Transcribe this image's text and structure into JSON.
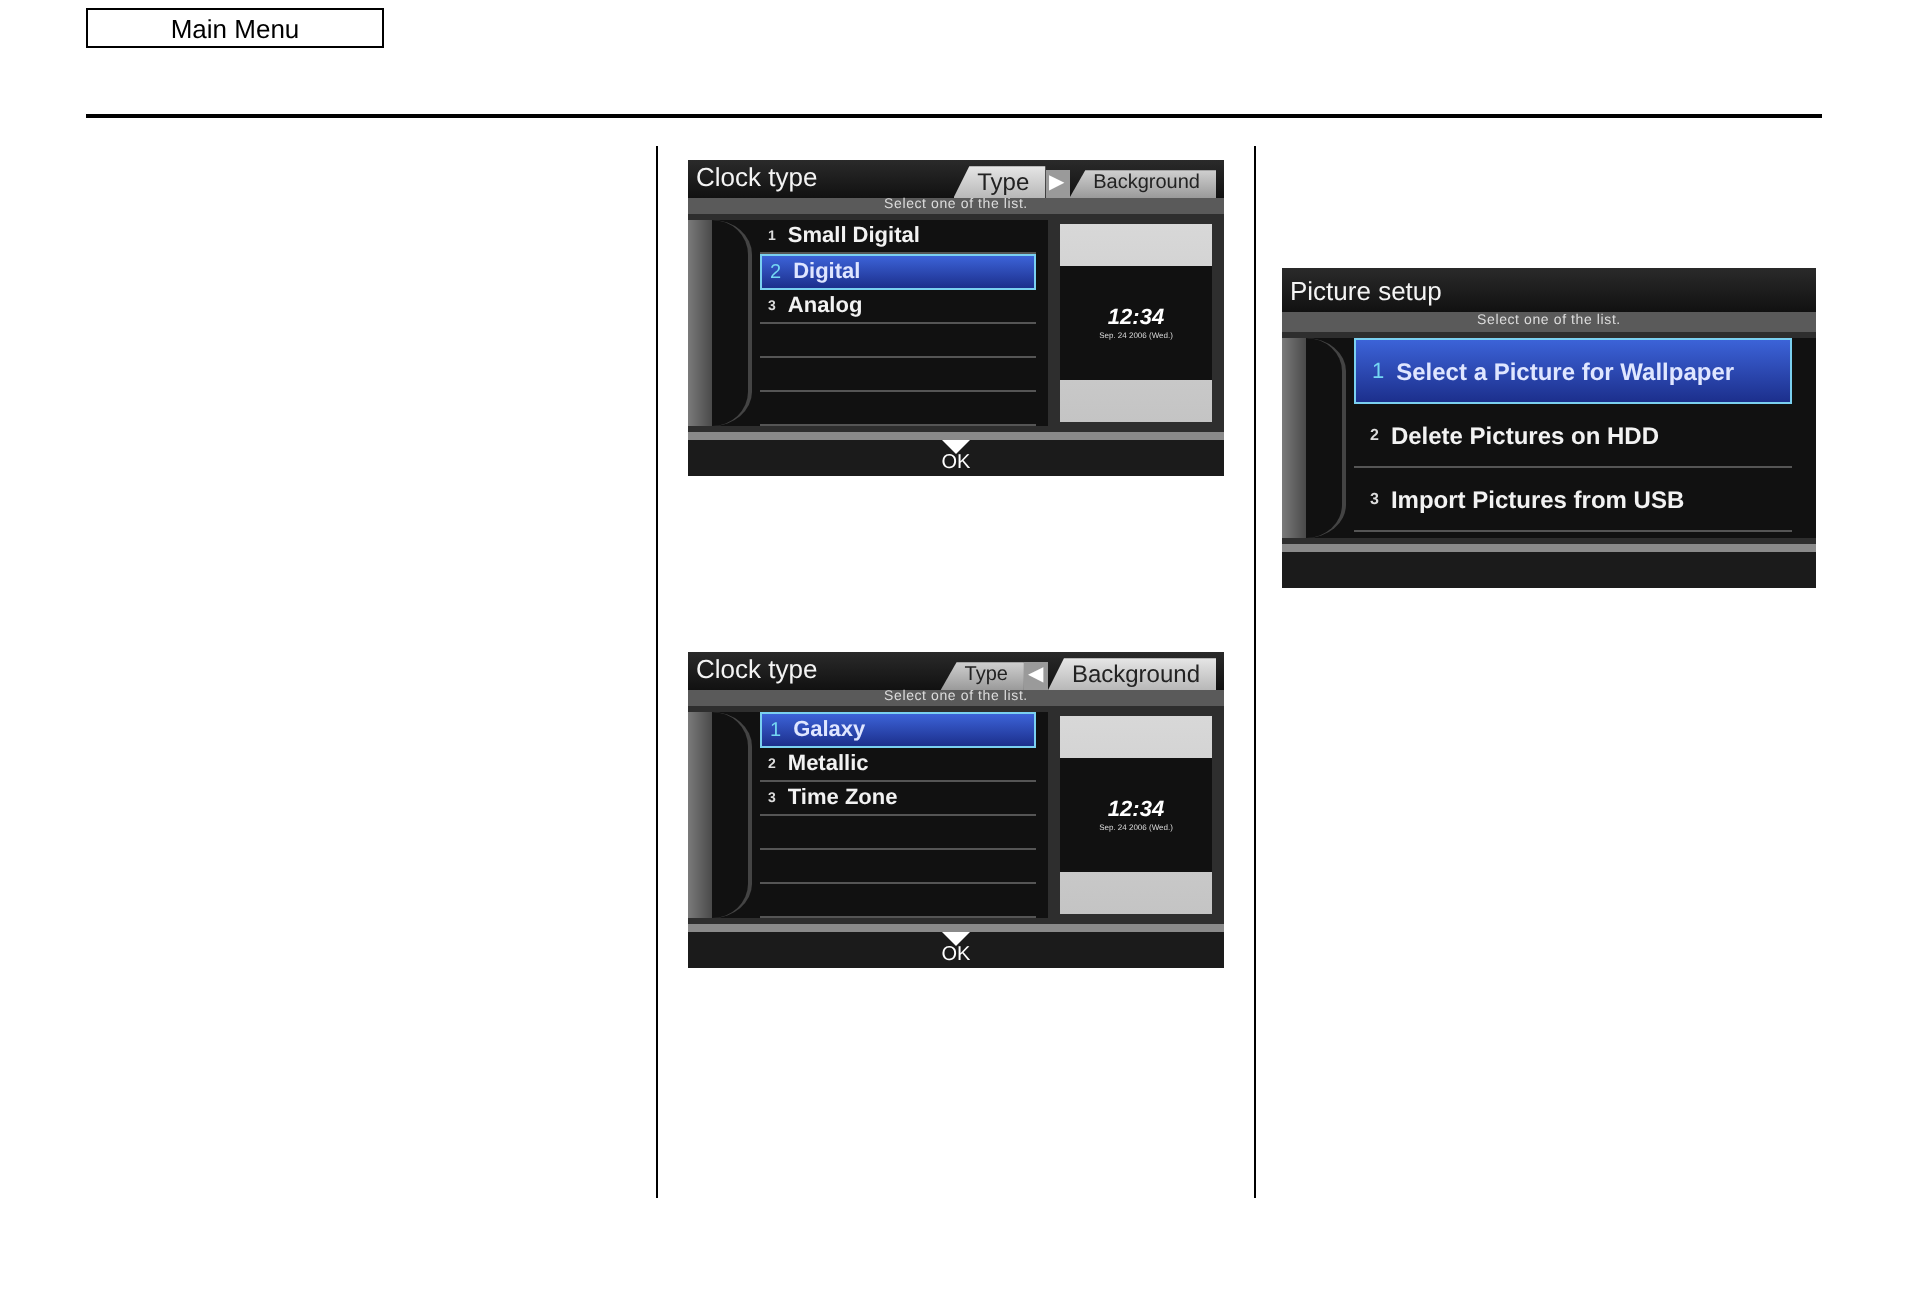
{
  "main_menu_button": "Main Menu",
  "screens": [
    {
      "title": "Clock type",
      "tabs": [
        {
          "label": "Type",
          "selected": true
        },
        {
          "label": "Background",
          "selected": false
        }
      ],
      "tab_arrow": "▶",
      "hint": "Select one of the list.",
      "items": [
        {
          "number": "1",
          "label": "Small Digital",
          "selected": false
        },
        {
          "number": "2",
          "label": "Digital",
          "selected": true
        },
        {
          "number": "3",
          "label": "Analog",
          "selected": false
        }
      ],
      "preview": {
        "time": "12:34",
        "date": "Sep. 24 2006 (Wed.)"
      },
      "ok": "OK"
    },
    {
      "title": "Clock type",
      "tabs": [
        {
          "label": "Type",
          "selected": false
        },
        {
          "label": "Background",
          "selected": true
        }
      ],
      "tab_arrow": "◀",
      "hint": "Select one of the list.",
      "items": [
        {
          "number": "1",
          "label": "Galaxy",
          "selected": true
        },
        {
          "number": "2",
          "label": "Metallic",
          "selected": false
        },
        {
          "number": "3",
          "label": "Time Zone",
          "selected": false
        }
      ],
      "preview": {
        "time": "12:34",
        "date": "Sep. 24 2006 (Wed.)"
      },
      "ok": "OK"
    },
    {
      "title": "Picture setup",
      "hint": "Select one of the list.",
      "items": [
        {
          "number": "1",
          "label": "Select a Picture for Wallpaper",
          "selected": true
        },
        {
          "number": "2",
          "label": "Delete Pictures on HDD",
          "selected": false
        },
        {
          "number": "3",
          "label": "Import Pictures from USB",
          "selected": false
        }
      ]
    }
  ]
}
